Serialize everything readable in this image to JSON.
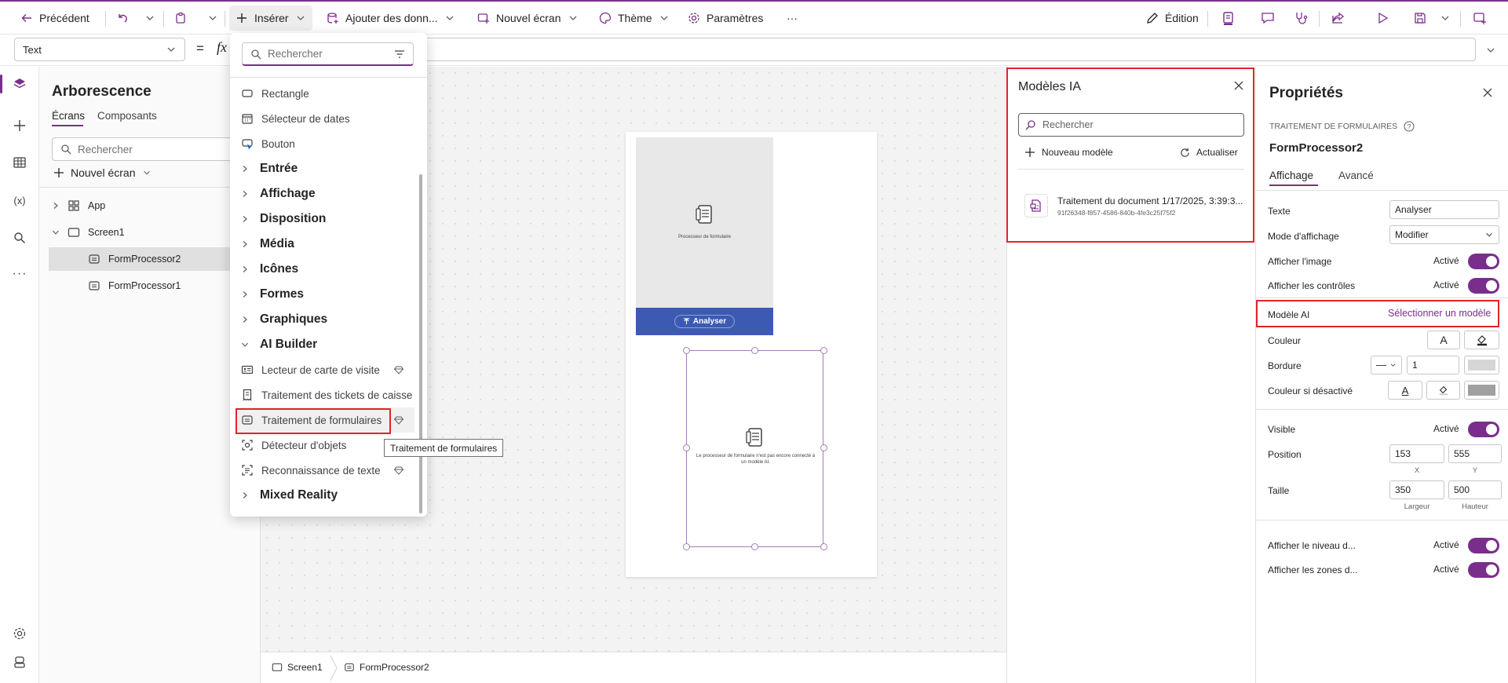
{
  "toolbar": {
    "back": "Précédent",
    "insert": "Insérer",
    "add_data": "Ajouter des donn...",
    "new_screen": "Nouvel écran",
    "theme": "Thème",
    "settings": "Paramètres",
    "more": "···",
    "edit": "Édition"
  },
  "formula": {
    "property": "Text",
    "equals": "=",
    "fx": "fx"
  },
  "tree": {
    "title": "Arborescence",
    "tabs": [
      "Écrans",
      "Composants"
    ],
    "search_placeholder": "Rechercher",
    "new_screen": "Nouvel écran",
    "items": [
      "App",
      "Screen1",
      "FormProcessor2",
      "FormProcessor1"
    ]
  },
  "insert_menu": {
    "search_placeholder": "Rechercher",
    "items": [
      "Rectangle",
      "Sélecteur de dates",
      "Bouton"
    ],
    "categories": [
      "Entrée",
      "Affichage",
      "Disposition",
      "Média",
      "Icônes",
      "Formes",
      "Graphiques",
      "AI Builder"
    ],
    "ai_items": [
      "Lecteur de carte de visite",
      "Traitement des tickets de caisse",
      "Traitement de formulaires",
      "Détecteur d'objets",
      "Reconnaissance de texte"
    ],
    "last_category": "Mixed Reality",
    "tooltip": "Traitement de formulaires"
  },
  "canvas": {
    "form1_label": "Processeur de formulaire",
    "button": "Analyser",
    "form2_message": "Le processeur de formulaire n'est pas encore connecté à un modèle AI."
  },
  "statusbar": {
    "screen": "Screen1",
    "control": "FormProcessor2"
  },
  "ai_panel": {
    "title": "Modèles IA",
    "search_placeholder": "Rechercher",
    "new_model": "Nouveau modèle",
    "refresh": "Actualiser",
    "model_name": "Traitement du document 1/17/2025, 3:39:3...",
    "model_id": "91f26348-f857-4586-840b-4fe3c25f75f2"
  },
  "props": {
    "title": "Propriétés",
    "type": "TRAITEMENT DE FORMULAIRES",
    "name": "FormProcessor2",
    "tabs": [
      "Affichage",
      "Avancé"
    ],
    "text_label": "Texte",
    "text_value": "Analyser",
    "mode_label": "Mode d'affichage",
    "mode_value": "Modifier",
    "show_image": "Afficher l'image",
    "show_controls": "Afficher les contrôles",
    "on": "Activé",
    "model_label": "Modèle AI",
    "model_link": "Sélectionner un modèle",
    "color": "Couleur",
    "border": "Bordure",
    "border_width": "1",
    "disabled_color": "Couleur si désactivé",
    "visible": "Visible",
    "position": "Position",
    "pos_x": "153",
    "pos_y": "555",
    "x": "X",
    "y": "Y",
    "size": "Taille",
    "width": "350",
    "height": "500",
    "width_label": "Largeur",
    "height_label": "Hauteur",
    "show_level": "Afficher le niveau d...",
    "show_zones": "Afficher les zones d..."
  },
  "colors": {
    "accent": "#7a2e8c",
    "highlight": "#e0242b",
    "button_blue": "#3d5ab3"
  }
}
